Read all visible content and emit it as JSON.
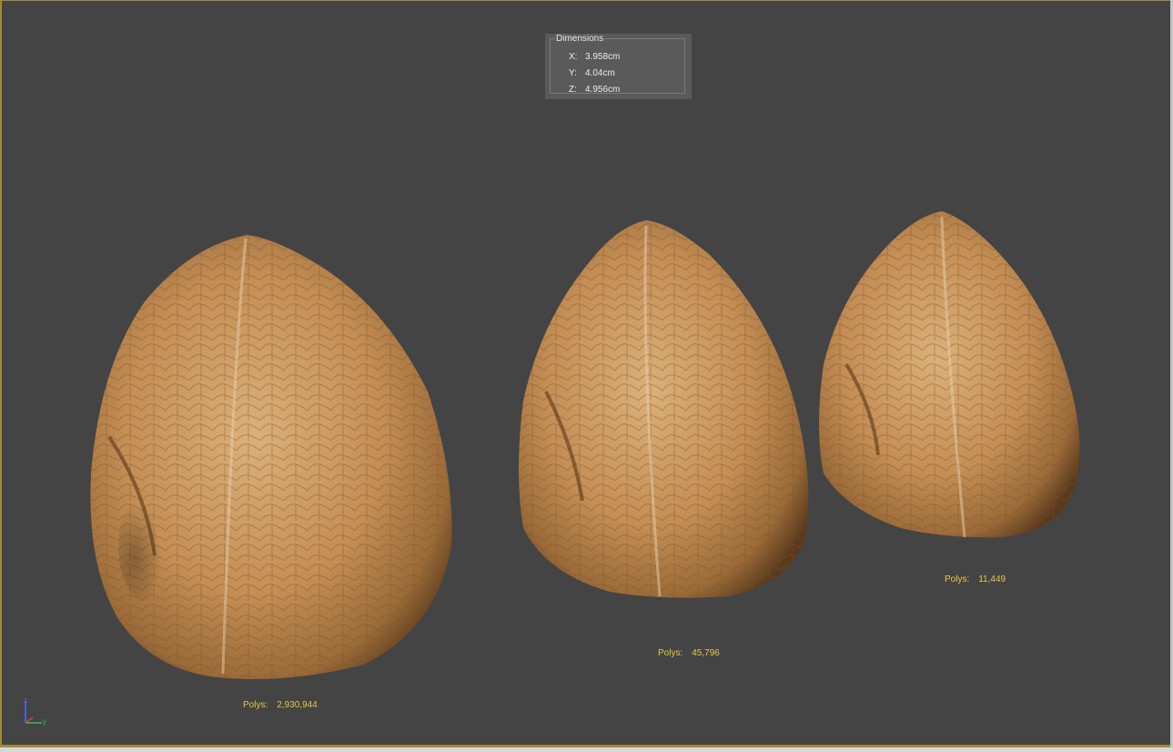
{
  "dimensions": {
    "title": "Dimensions",
    "rows": [
      {
        "axis": "X:",
        "value": "3.958cm"
      },
      {
        "axis": "Y:",
        "value": "4.04cm"
      },
      {
        "axis": "Z:",
        "value": "4.956cm"
      }
    ]
  },
  "models": [
    {
      "polys_label": "Polys:",
      "polys_value": "2,930,944"
    },
    {
      "polys_label": "Polys:",
      "polys_value": "45,796"
    },
    {
      "polys_label": "Polys:",
      "polys_value": "11,449"
    }
  ],
  "gizmo": {
    "z_label": "z",
    "y_label": "y"
  },
  "colors": {
    "viewport_bg": "#444444",
    "polys_text": "#e8c846",
    "frame_border": "#a08a3c",
    "walnut": "#c8955a"
  }
}
